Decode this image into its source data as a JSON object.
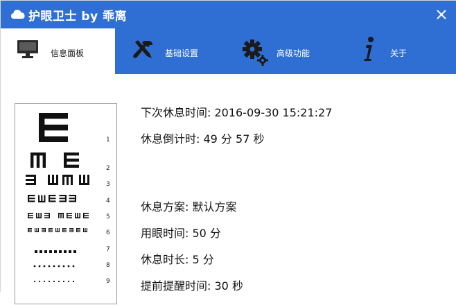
{
  "window": {
    "title": "护眼卫士 by 乖离",
    "title_icon": "cloud-icon",
    "close_icon": "close-icon"
  },
  "tabs": [
    {
      "label": "信息面板",
      "icon": "monitor-icon",
      "active": true
    },
    {
      "label": "基础设置",
      "icon": "tools-icon",
      "active": false
    },
    {
      "label": "高级功能",
      "icon": "gears-icon",
      "active": false
    },
    {
      "label": "关于",
      "icon": "info-icon",
      "active": false
    }
  ],
  "eye_chart": {
    "row_numbers": [
      "1",
      "2",
      "3",
      "4",
      "5",
      "6",
      "7",
      "8",
      "9"
    ]
  },
  "info": {
    "next_rest": "下次休息时间: 2016-09-30 15:21:27",
    "countdown": "休息倒计时: 49 分 57 秒",
    "rest_plan": "休息方案: 默认方案",
    "eye_use_time": "用眼时间: 50 分",
    "rest_duration": "休息时长: 5 分",
    "advance_reminder": "提前提醒时间: 30 秒"
  },
  "colors": {
    "title_bar": "#2f6ed3",
    "tab_bar": "#2f6ed3",
    "active_tab": "#ffffff"
  }
}
